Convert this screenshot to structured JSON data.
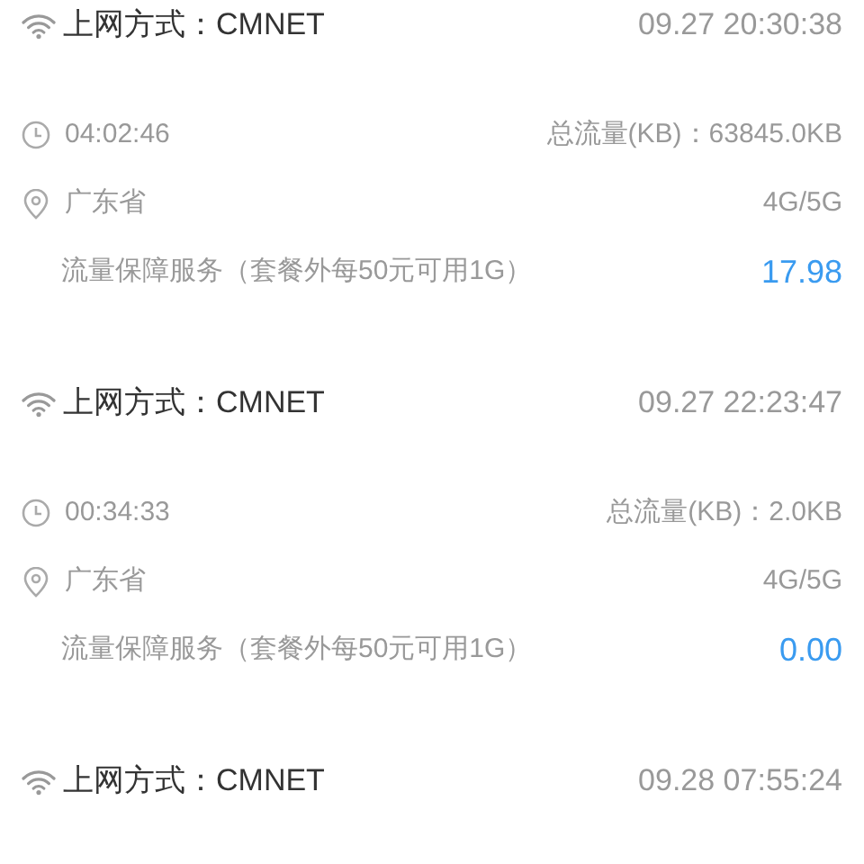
{
  "records": [
    {
      "title": "上网方式：CMNET",
      "datetime": "09.27 20:30:38",
      "duration": "04:02:46",
      "total": "总流量(KB)：63845.0KB",
      "province": "广东省",
      "network": "4G/5G",
      "service": "流量保障服务（套餐外每50元可用1G）",
      "fee": "17.98"
    },
    {
      "title": "上网方式：CMNET",
      "datetime": "09.27 22:23:47",
      "duration": "00:34:33",
      "total": "总流量(KB)：2.0KB",
      "province": "广东省",
      "network": "4G/5G",
      "service": "流量保障服务（套餐外每50元可用1G）",
      "fee": "0.00"
    },
    {
      "title": "上网方式：CMNET",
      "datetime": "09.28 07:55:24"
    }
  ]
}
